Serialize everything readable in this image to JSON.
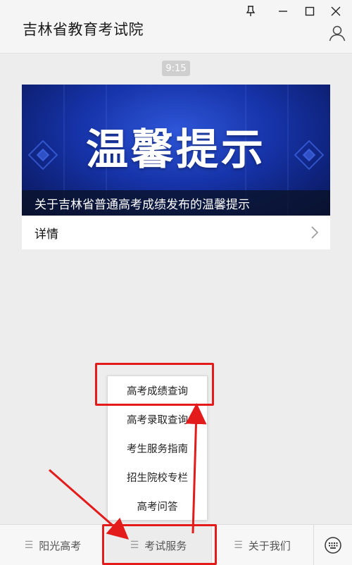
{
  "header": {
    "title": "吉林省教育考试院",
    "icons": {
      "pin": "pin-icon",
      "minimize": "minimize-icon",
      "maximize": "maximize-icon",
      "close": "close-icon",
      "profile": "profile-icon"
    }
  },
  "chat": {
    "time": "9:15",
    "article": {
      "banner_headline": "温馨提示",
      "title": "关于吉林省普通高考成绩发布的温馨提示",
      "details_label": "详情"
    }
  },
  "popup_menu": {
    "items": [
      {
        "label": "高考成绩查询"
      },
      {
        "label": "高考录取查询"
      },
      {
        "label": "考生服务指南"
      },
      {
        "label": "招生院校专栏"
      },
      {
        "label": "高考问答"
      }
    ]
  },
  "bottom_menu": {
    "tabs": [
      {
        "label": "阳光高考"
      },
      {
        "label": "考试服务"
      },
      {
        "label": "关于我们"
      }
    ],
    "keyboard_icon": "keyboard-icon"
  },
  "colors": {
    "highlight": "#e31b1b",
    "banner_blue": "#1633a8",
    "background": "#ededed"
  }
}
